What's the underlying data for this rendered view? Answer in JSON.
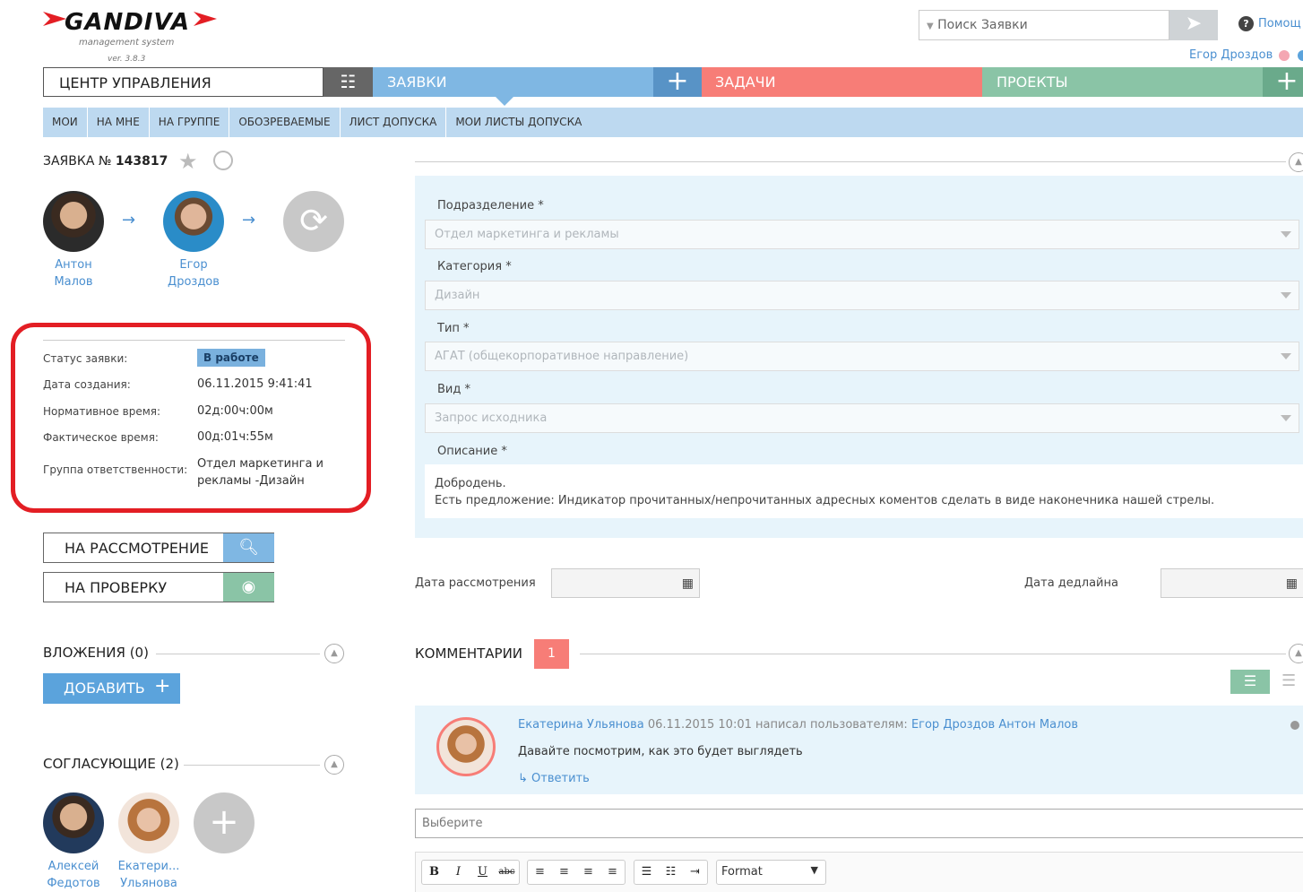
{
  "header": {
    "logo_text": "GANDIVA",
    "logo_subtitle": "management system",
    "version": "ver. 3.8.3",
    "search_placeholder": "Поиск Заявки",
    "help_label": "Помощ",
    "user_name": "Егор Дроздов"
  },
  "main_nav": {
    "control_center": "ЦЕНТР УПРАВЛЕНИЯ",
    "requests": "ЗАЯВКИ",
    "tasks": "ЗАДАЧИ",
    "projects": "ПРОЕКТЫ"
  },
  "sub_nav": [
    "МОИ",
    "НА МНЕ",
    "НА ГРУППЕ",
    "ОБОЗРЕВАЕМЫЕ",
    "ЛИСТ ДОПУСКА",
    "МОИ ЛИСТЫ ДОПУСКА"
  ],
  "request": {
    "title_prefix": "ЗАЯВКА №",
    "number": "143817",
    "people": [
      {
        "first": "Антон",
        "last": "Малов"
      },
      {
        "first": "Егор",
        "last": "Дроздов"
      }
    ],
    "info": {
      "status_label": "Статус заявки:",
      "status_value": "В работе",
      "created_label": "Дата создания:",
      "created_value": "06.11.2015 9:41:41",
      "norm_time_label": "Нормативное время:",
      "norm_time_value": "02д:00ч:00м",
      "actual_time_label": "Фактическое время:",
      "actual_time_value": "00д:01ч:55м",
      "group_label": "Группа ответственности:",
      "group_value_line1": "Отдел маркетинга и",
      "group_value_line2": "рекламы -Дизайн"
    },
    "btn_review": "НА РАССМОТРЕНИЕ",
    "btn_check": "НА ПРОВЕРКУ",
    "attachments_title": "ВЛОЖЕНИЯ (0)",
    "add_label": "ДОБАВИТЬ",
    "approvers_title": "СОГЛАСУЮЩИЕ (2)",
    "approvers": [
      {
        "first": "Алексей",
        "last": "Федотов"
      },
      {
        "first": "Екатери...",
        "last": "Ульянова"
      }
    ]
  },
  "form": {
    "department_label": "Подразделение *",
    "department_value": "Отдел маркетинга и рекламы",
    "category_label": "Категория *",
    "category_value": "Дизайн",
    "type_label": "Тип *",
    "type_value": "АГАТ (общекорпоративное направление)",
    "kind_label": "Вид *",
    "kind_value": "Запрос исходника",
    "description_label": "Описание *",
    "description_line1": "Добродень.",
    "description_line2": "Есть предложение: Индикатор прочитанных/непрочитанных адресных коментов сделать в виде наконечника нашей стрелы.",
    "review_date_label": "Дата рассмотрения",
    "deadline_label": "Дата дедлайна"
  },
  "comments": {
    "title": "КОММЕНТАРИИ",
    "count": "1",
    "items": [
      {
        "author": "Екатерина Ульянова",
        "datetime": "06.11.2015 10:01",
        "wrote_to": "написал пользователям:",
        "recipients": "Егор Дроздов Антон Малов",
        "text": "Давайте посмотрим, как это будет выглядеть",
        "reply": "Ответить"
      }
    ],
    "select_placeholder": "Выберите",
    "format_label": "Format"
  }
}
